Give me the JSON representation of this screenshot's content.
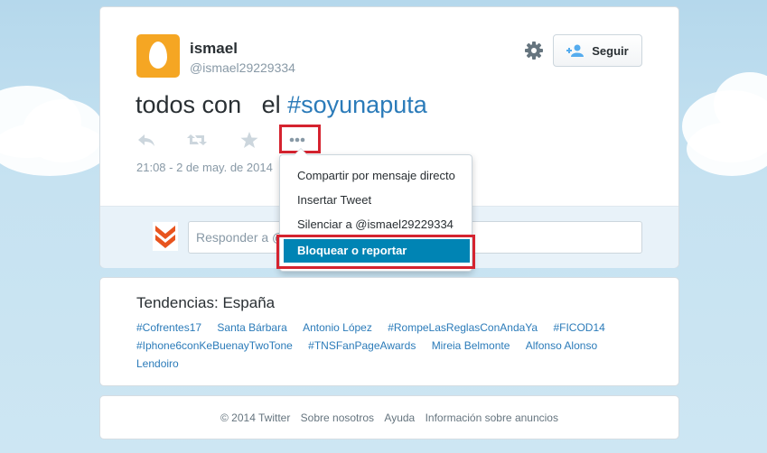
{
  "tweet": {
    "fullname": "ismael",
    "screen_name": "@ismael29229334",
    "text_plain": "todos con   el ",
    "hashtag": "#soyunaputa",
    "timestamp": "21:08 - 2 de may. de 2014",
    "follow_label": "Seguir",
    "reply_placeholder": "Responder a @"
  },
  "more_menu": {
    "items": [
      "Compartir por mensaje directo",
      "Insertar Tweet",
      "Silenciar a @ismael29229334",
      "Bloquear o reportar"
    ],
    "active_index": 3
  },
  "trends": {
    "title": "Tendencias: España",
    "items": [
      "#Cofrentes17",
      "Santa Bárbara",
      "Antonio López",
      "#RompeLasReglasConAndaYa",
      "#FICOD14",
      "#Iphone6conKeBuenayTwoTone",
      "#TNSFanPageAwards",
      "Mireia Belmonte",
      "Alfonso Alonso",
      "Lendoiro"
    ]
  },
  "footer": {
    "copyright": "© 2014 Twitter",
    "links": [
      "Sobre nosotros",
      "Ayuda",
      "Información sobre anuncios"
    ]
  },
  "colors": {
    "link": "#2b7bb9",
    "menu_active": "#0084b4",
    "highlight_red": "#d5232f",
    "avatar_bg": "#f5a623"
  }
}
